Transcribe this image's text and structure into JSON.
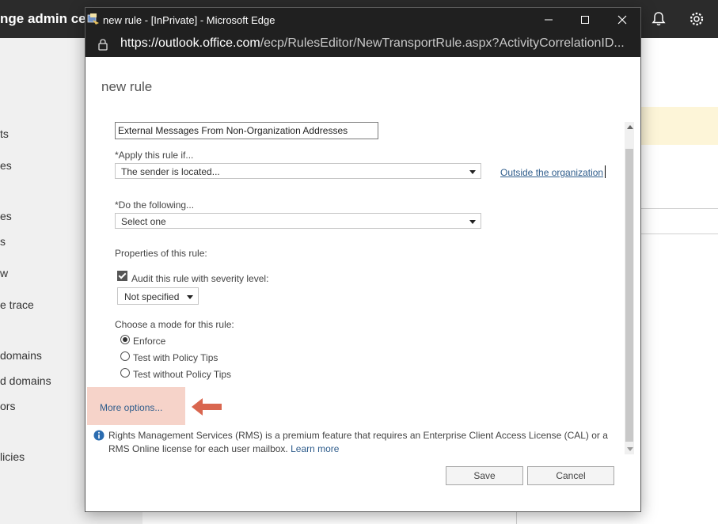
{
  "background_app": {
    "title": "nge admin cen",
    "sidebar_items": [
      "ts",
      "es",
      "es",
      "s",
      "w",
      "e trace",
      "domains",
      "d domains",
      "ors",
      "licies"
    ]
  },
  "window": {
    "title": "new rule - [InPrivate] - Microsoft Edge",
    "url_host": "https://outlook.office.com",
    "url_path": "/ecp/RulesEditor/NewTransportRule.aspx?ActivityCorrelationID..."
  },
  "form": {
    "heading": "new rule",
    "name_value": "External Messages From Non-Organization Addresses",
    "apply_label": "*Apply this rule if...",
    "apply_value": "The sender is located...",
    "apply_condition_link": "Outside the organization",
    "do_label": "*Do the following...",
    "do_value": "Select one",
    "properties_label": "Properties of this rule:",
    "audit_label": "Audit this rule with severity level:",
    "audit_checked": true,
    "severity_value": "Not specified",
    "mode_label": "Choose a mode for this rule:",
    "modes": [
      "Enforce",
      "Test with Policy Tips",
      "Test without Policy Tips"
    ],
    "selected_mode": "Enforce",
    "more_options": "More options...",
    "info_text": "Rights Management Services (RMS) is a premium feature that requires an Enterprise Client Access License (CAL) or a RMS Online license for each user mailbox.",
    "learn_more": "Learn more",
    "save_label": "Save",
    "cancel_label": "Cancel"
  },
  "colors": {
    "highlight": "#f6d3c9",
    "arrow": "#d9664f",
    "link": "#2f5d8c",
    "titlebar": "#202020"
  }
}
